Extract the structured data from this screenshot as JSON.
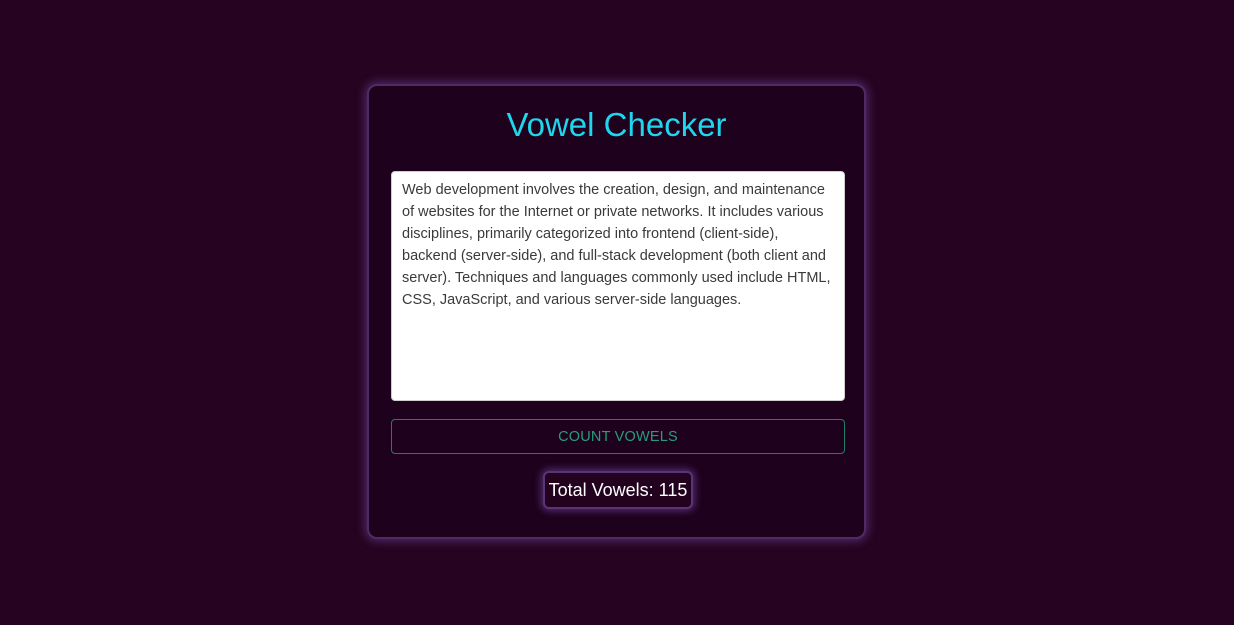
{
  "app": {
    "title": "Vowel Checker"
  },
  "input": {
    "value": "Web development involves the creation, design, and maintenance of websites for the Internet or private networks. It includes various disciplines, primarily categorized into frontend (client-side), backend (server-side), and full-stack development (both client and server). Techniques and languages commonly used include HTML, CSS, JavaScript, and various server-side languages."
  },
  "button": {
    "label": "COUNT VOWELS"
  },
  "result": {
    "text": "Total Vowels: 115"
  },
  "colors": {
    "page_background": "#260320",
    "card_background": "#1e011d",
    "title": "#1fd6ec",
    "button_border": "#1f7f64",
    "button_text": "#2a9c7b",
    "result_glow": "#8c5ac4"
  }
}
